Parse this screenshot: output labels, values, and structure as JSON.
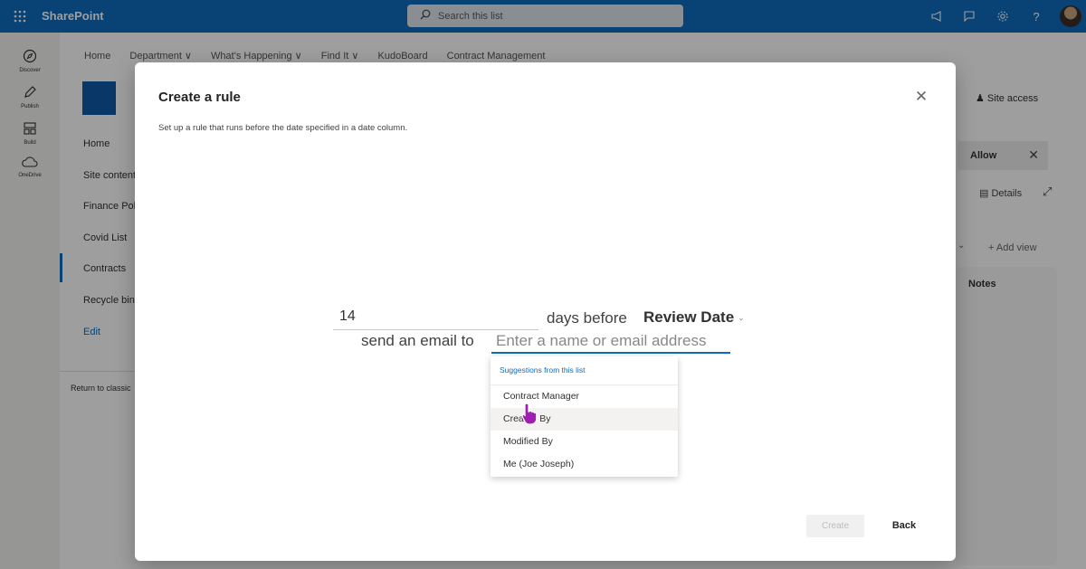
{
  "suite": {
    "brand": "SharePoint",
    "search_placeholder": "Search this list",
    "icons": [
      "waffle-icon",
      "megaphone-icon",
      "feedback-icon",
      "settings-icon",
      "help-icon"
    ]
  },
  "appbar": {
    "items": [
      {
        "label": "Discover",
        "icon": "compass-icon"
      },
      {
        "label": "Publish",
        "icon": "pen-icon"
      },
      {
        "label": "Build",
        "icon": "build-icon"
      },
      {
        "label": "OneDrive",
        "icon": "cloud-icon"
      }
    ]
  },
  "site": {
    "topnav": [
      "Home",
      "Department ∨",
      "What's Happening ∨",
      "Find It ∨",
      "KudoBoard",
      "Contract Management"
    ],
    "leftnav": [
      "Home",
      "Site content",
      "Finance Pol",
      "Covid List",
      "Contracts",
      "Recycle bin",
      "Edit"
    ],
    "return_classic": "Return to classic",
    "site_access": "Site access",
    "allow": "Allow",
    "details": "Details",
    "add_view": "Add view",
    "notes": "Notes"
  },
  "dialog": {
    "title": "Create a rule",
    "subtitle": "Set up a rule that runs before the date specified in a date column.",
    "days_value": "14",
    "days_before_text": "days before",
    "date_column": "Review Date",
    "send_email_text": "send an email to",
    "email_placeholder": "Enter a name or email address",
    "suggestions_header": "Suggestions from this list",
    "suggestions": [
      "Contract Manager",
      "Created By",
      "Modified By",
      "Me (Joe Joseph)"
    ],
    "create_label": "Create",
    "back_label": "Back"
  }
}
